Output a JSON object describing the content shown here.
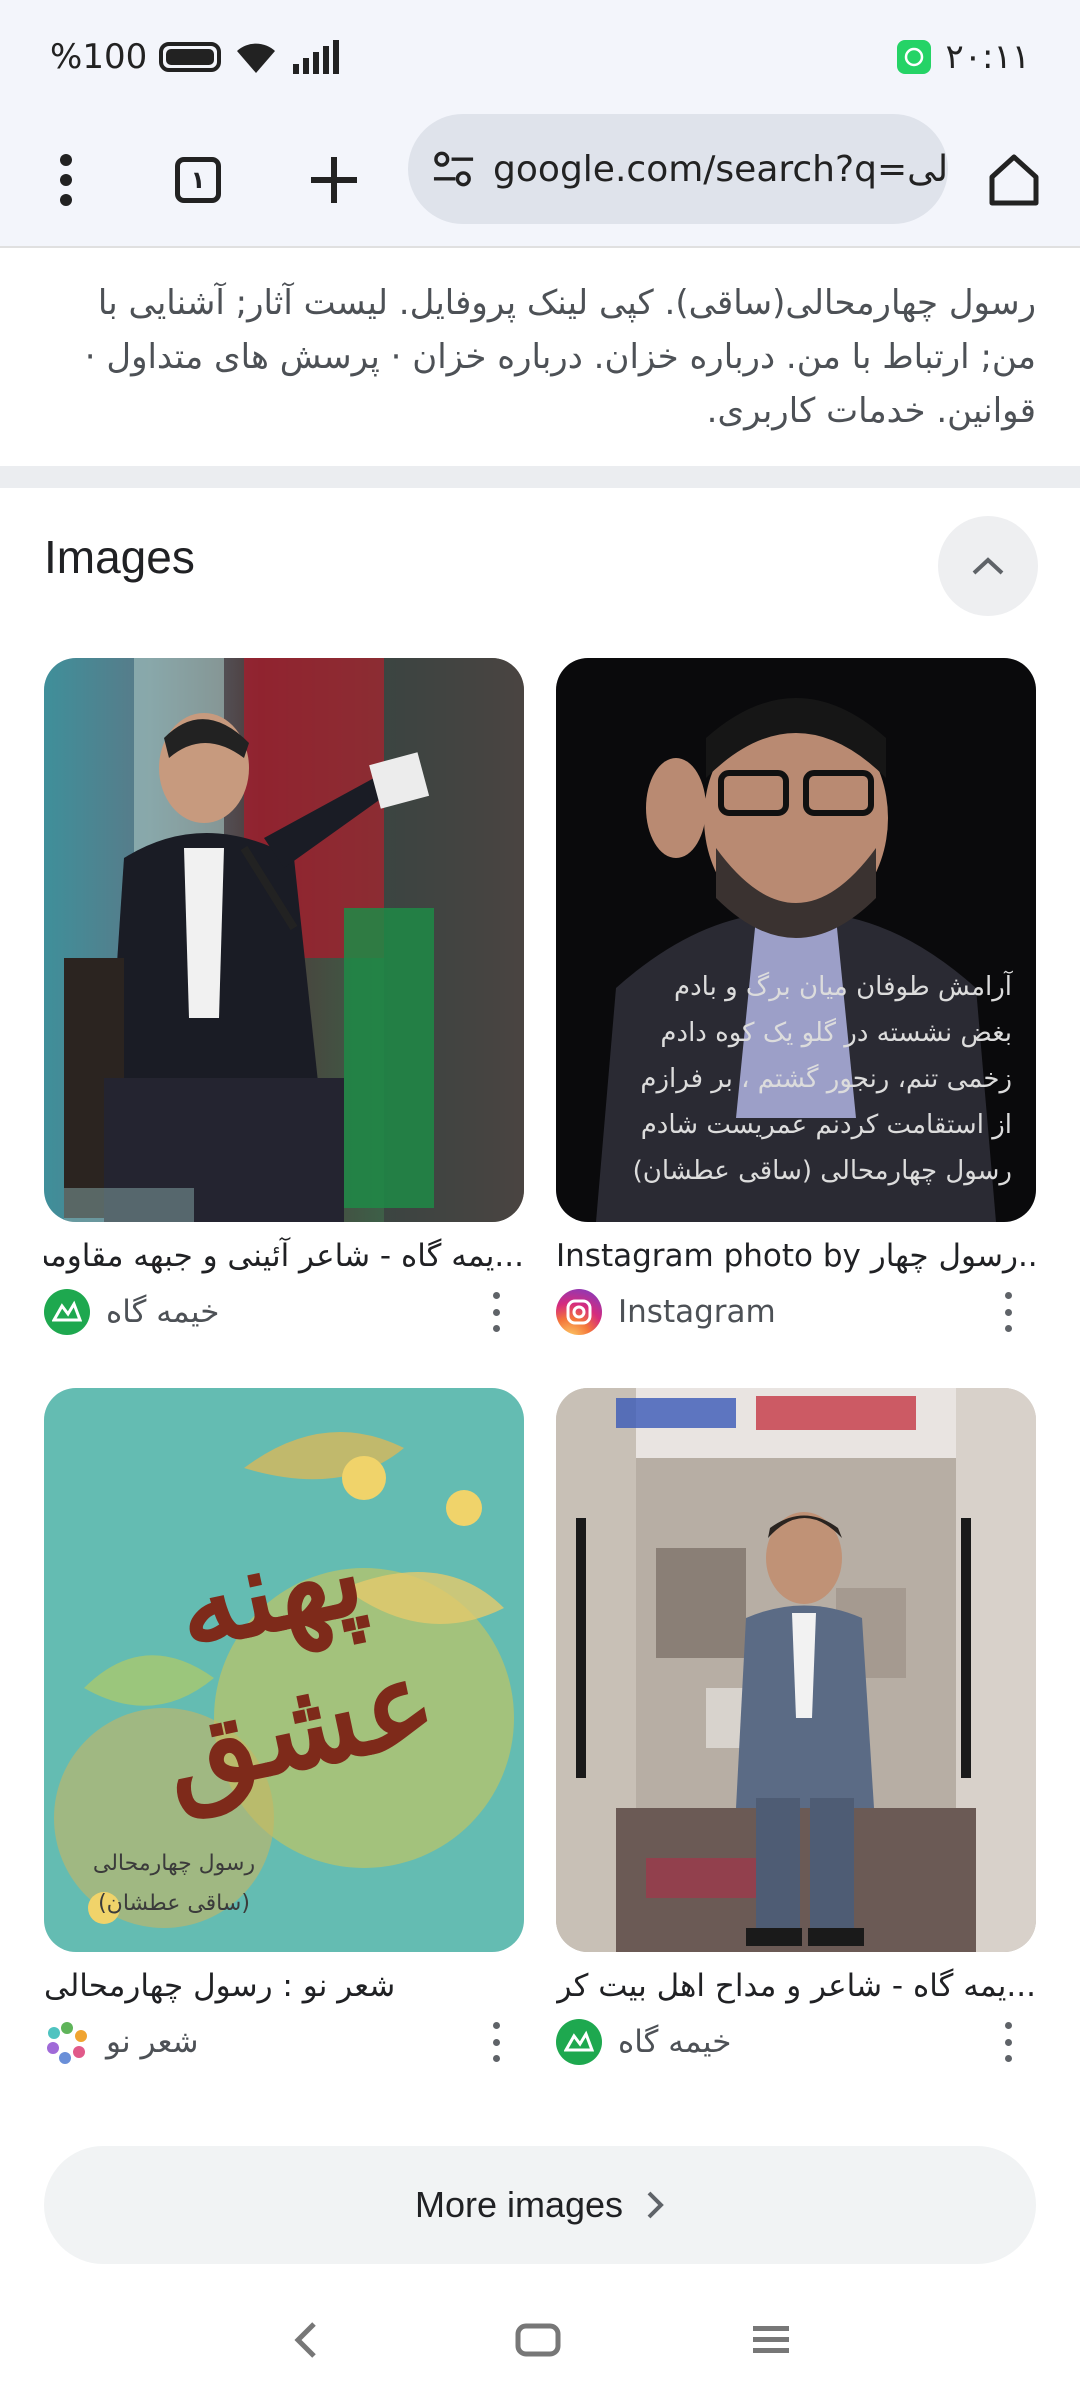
{
  "status": {
    "battery": "100",
    "battery_pct": "%",
    "time": "۲۰:۱۱"
  },
  "toolbar": {
    "tabs_count": "۱",
    "url": "google.com/search?q=الی"
  },
  "snippet": {
    "text": "رسول چهارمحالی(ساقی). کپی لینک پروفایل. لیست آثار; آشنایی با من; ارتباط با من. درباره خزان. درباره خزان · پرسش های متداول · قوانین. خدمات کاربری."
  },
  "images_section": {
    "title": "Images",
    "items": [
      {
        "caption": "...یمه گاه - شاعر آئینی و جبهه مقاومت",
        "source": "خیمه گاه",
        "icon": "khimegah-logo"
      },
      {
        "caption": "Instagram photo by رسول چهار...",
        "source": "Instagram",
        "icon": "instagram-logo",
        "overlay": [
          "آرامش طوفان میان برگ و بادم",
          "بغض نشسته در گلو یک کوه دادم",
          "زخمی تنم، رنجور گشتم ، بر فرازم",
          "از استقامت کردنم عمریست شادم",
          "رسول چهارمحالی (ساقی عطشان)"
        ]
      },
      {
        "caption": "شعر نو : رسول چهارمحالی",
        "source": "شعر نو",
        "icon": "shereno-logo",
        "calligraphy": "پهنه عشق",
        "overlay": [
          "رسول چهارمحالی",
          "(ساقی عطشان)"
        ]
      },
      {
        "caption": "...یمه گاه - شاعر و مداح اهل بیت کربلا",
        "source": "خیمه گاه",
        "icon": "khimegah-logo"
      }
    ],
    "more_label": "More images"
  },
  "colors": {
    "chrome_bg": "#f3f5fb",
    "url_bg": "#dfe3eb",
    "divider": "#ebedf0",
    "whatsapp": "#25d366",
    "khimegah": "#1ea84f"
  }
}
